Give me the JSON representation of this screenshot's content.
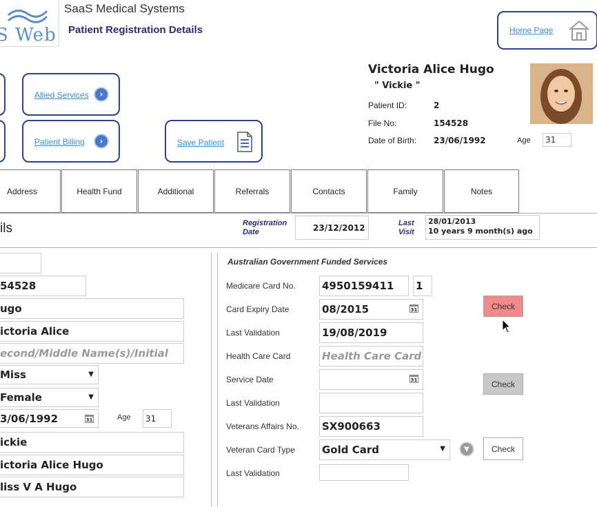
{
  "header": {
    "logo_text": "S Web",
    "company": "SaaS Medical Systems",
    "page_title": "Patient Registration Details",
    "home_link": "Home Page"
  },
  "actions": {
    "allied_services": "Allied Services",
    "patient_billing": "Patient Billing",
    "save_patient": "Save Patient"
  },
  "patient": {
    "name": "Victoria Alice Hugo",
    "nickname": "\" Vickie \"",
    "id_label": "Patient ID:",
    "id_value": "2",
    "file_label": "File No:",
    "file_value": "154528",
    "dob_label": "Date of Birth:",
    "dob_value": "23/06/1992",
    "age_label": "Age",
    "age_value": "31"
  },
  "tabs": [
    "Address",
    "Health Fund",
    "Additional",
    "Referrals",
    "Contacts",
    "Family",
    "Notes"
  ],
  "section": {
    "title_fragment": "ils",
    "reg_label_1": "Registration",
    "reg_label_2": "Date",
    "reg_value": "23/12/2012",
    "visit_label_1": "Last",
    "visit_label_2": "Visit",
    "visit_value_1": "28/01/2013",
    "visit_value_2": "10 years 9 month(s) ago"
  },
  "left_form": {
    "file_no": "54528",
    "surname": "ugo",
    "first_name": "ictoria Alice",
    "middle_placeholder": "econd/Middle Name(s)/Initial",
    "title": "Miss",
    "gender": "Female",
    "dob": "3/06/1992",
    "age_label": "Age",
    "age_value": "31",
    "preferred": "ickie",
    "full_name": "ictoria Alice Hugo",
    "salutation": "liss V A Hugo"
  },
  "gov": {
    "heading": "Australian Government Funded Services",
    "medicare_label": "Medicare Card No.",
    "medicare_value": "4950159411",
    "medicare_irn": "1",
    "expiry_label": "Card Expiry Date",
    "expiry_value": "08/2015",
    "last_validation_label": "Last Validation",
    "last_validation_value": "19/08/2019",
    "health_card_label": "Health Care Card",
    "health_card_placeholder": "Health Care Card",
    "service_date_label": "Service Date",
    "last_validation_2_label": "Last Validation",
    "veterans_label": "Veterans Affairs No.",
    "veterans_value": "SX900663",
    "vet_type_label": "Veteran Card Type",
    "vet_type_value": "Gold Card",
    "last_validation_3_label": "Last Validation",
    "check_label": "Check",
    "cal_text": "31"
  },
  "colors": {
    "accent": "#2f3f8f",
    "title": "#2b2b6e",
    "link": "#3a8ad6",
    "check_red": "#f08a8a"
  }
}
